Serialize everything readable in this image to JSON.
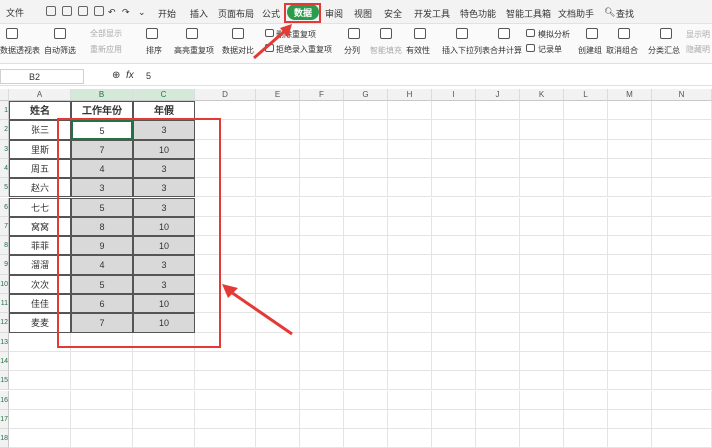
{
  "menu": {
    "file": "文件",
    "tabs": [
      "开始",
      "插入",
      "页面布局",
      "公式",
      "数据",
      "审阅",
      "视图",
      "安全",
      "开发工具",
      "特色功能",
      "智能工具箱",
      "文档助手"
    ],
    "active_tab": "数据",
    "search": "查找"
  },
  "ribbon": {
    "items": [
      "数据透视表",
      "自动筛选",
      "全部显示",
      "重新应用",
      "排序",
      "高亮重复项",
      "数据对比",
      "删除重复项",
      "拒绝录入重复项",
      "分列",
      "智能填充",
      "有效性",
      "插入下拉列表",
      "合并计算",
      "模拟分析",
      "记录单",
      "创建组",
      "取消组合",
      "分类汇总",
      "显示明",
      "隐藏明"
    ]
  },
  "formula_bar": {
    "cell_ref": "B2",
    "value": "5"
  },
  "columns": [
    "A",
    "B",
    "C",
    "D",
    "E",
    "F",
    "G",
    "H",
    "I",
    "J",
    "K",
    "L",
    "M",
    "N"
  ],
  "table": {
    "headers": [
      "姓名",
      "工作年份",
      "年假"
    ],
    "rows": [
      [
        "张三",
        "5",
        "3"
      ],
      [
        "里斯",
        "7",
        "10"
      ],
      [
        "周五",
        "4",
        "3"
      ],
      [
        "赵六",
        "3",
        "3"
      ],
      [
        "七七",
        "5",
        "3"
      ],
      [
        "窝窝",
        "8",
        "10"
      ],
      [
        "菲菲",
        "9",
        "10"
      ],
      [
        "溜溜",
        "4",
        "3"
      ],
      [
        "次次",
        "5",
        "3"
      ],
      [
        "佳佳",
        "6",
        "10"
      ],
      [
        "麦麦",
        "7",
        "10"
      ]
    ]
  },
  "row_numbers": [
    "1",
    "2",
    "3",
    "4",
    "5",
    "6",
    "7",
    "8",
    "9",
    "10",
    "11",
    "12",
    "13",
    "14",
    "15",
    "16",
    "17",
    "18"
  ],
  "colors": {
    "accent": "#2a9d4a",
    "annotation": "#e53935"
  }
}
